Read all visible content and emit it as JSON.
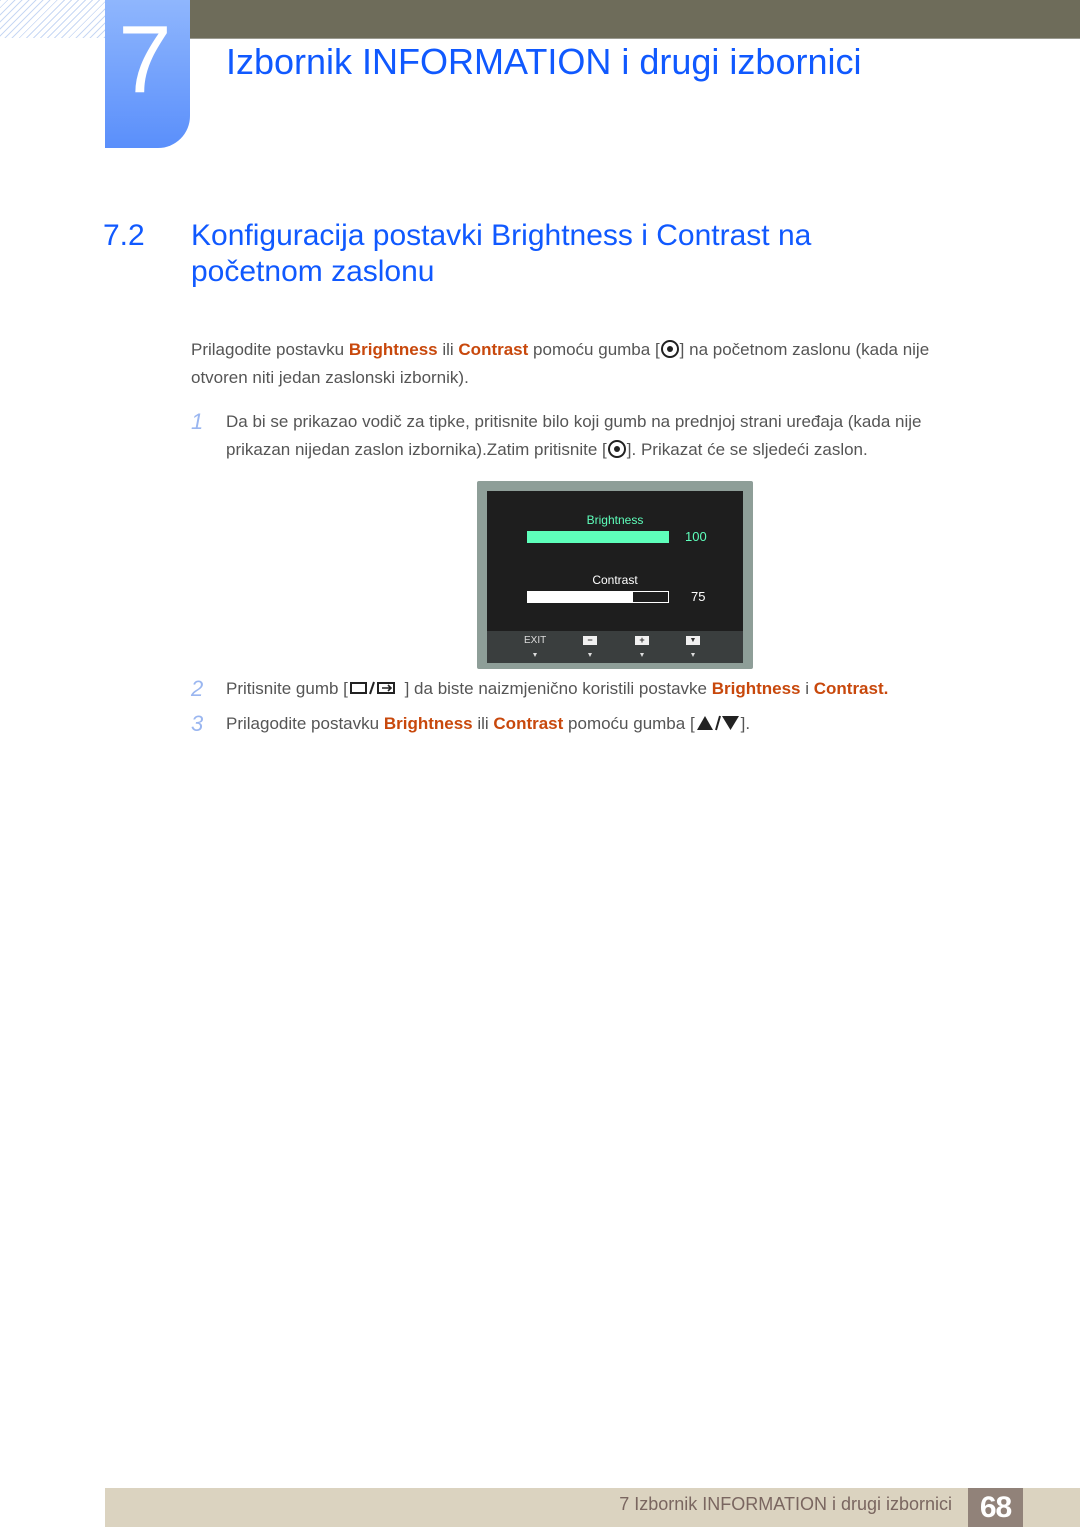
{
  "header": {
    "chapter_number": "7",
    "chapter_title": "Izbornik INFORMATION i drugi izbornici"
  },
  "section": {
    "number": "7.2",
    "title": "Konfiguracija postavki Brightness i Contrast na početnom zaslonu"
  },
  "intro": {
    "part1": "Prilagodite postavku ",
    "hl1": "Brightness",
    "part2": " ili ",
    "hl2": "Contrast",
    "part3": " pomoću gumba [",
    "icon": "joystick-press-icon",
    "part4": "] na početnom zaslonu (kada nije otvoren niti jedan zaslonski izbornik)."
  },
  "steps": [
    {
      "num": "1",
      "part1": "Da bi se prikazao vodič za tipke, pritisnite bilo koji gumb na prednjoj strani uređaja (kada nije prikazan nijedan zaslon izbornika).Zatim pritisnite [",
      "icon": "joystick-press-icon",
      "part2": "]. Prikazat će se sljedeći zaslon."
    },
    {
      "num": "2",
      "part1": "Pritisnite gumb [",
      "icon": "menu-source-icon",
      "part2": " ] da biste naizmjenično koristili postavke ",
      "hl1": "Brightness",
      "part3": " i ",
      "hl2": "Contrast",
      "part4": "."
    },
    {
      "num": "3",
      "part1": "Prilagodite postavku ",
      "hl1": "Brightness",
      "part2": " ili ",
      "hl2": "Contrast",
      "part3": " pomoću gumba [",
      "icon": "up-down-arrows-icon",
      "part4": "]."
    }
  ],
  "osd": {
    "brightness_label": "Brightness",
    "brightness_value": "100",
    "brightness_percent": 100,
    "contrast_label": "Contrast",
    "contrast_value": "75",
    "contrast_percent": 75,
    "active_color": "#5effbb",
    "buttons": [
      {
        "label": "EXIT",
        "icon": "exit-text"
      },
      {
        "label": "−",
        "icon": "minus-icon"
      },
      {
        "label": "+",
        "icon": "plus-icon"
      },
      {
        "label": "▼",
        "icon": "down-arrow-icon"
      }
    ]
  },
  "footer": {
    "text": "7 Izbornik INFORMATION i drugi izbornici",
    "page": "68"
  },
  "colors": {
    "heading_blue": "#1059ff",
    "highlight_orange": "#c8480c",
    "top_bar": "#6e6c5a",
    "footer_bg": "#dbd3c0",
    "footer_page_bg": "#918279"
  }
}
